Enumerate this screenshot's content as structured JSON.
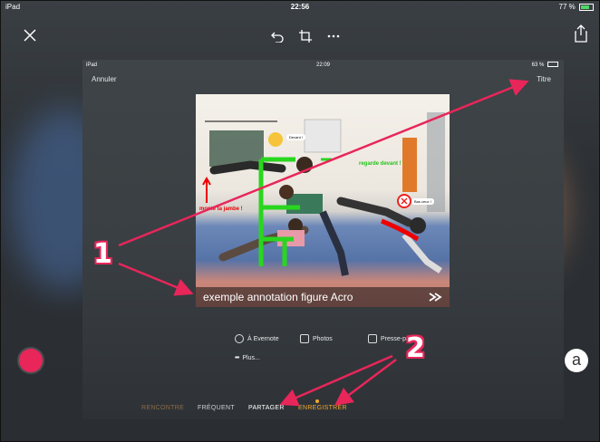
{
  "status": {
    "device": "iPad",
    "time": "22:56",
    "battery": "77 %"
  },
  "inner": {
    "status": {
      "device": "iPad",
      "time": "22:09",
      "battery": "63 %"
    },
    "nav": {
      "cancel": "Annuler",
      "title": "Titre"
    },
    "photo": {
      "caption": "exemple annotation figure Acro",
      "annotations": [
        {
          "text": "Devant !"
        },
        {
          "text": "regarde devant !"
        },
        {
          "text": "monte ta jambe !"
        },
        {
          "text": "Bas ceux !"
        }
      ]
    },
    "share": [
      {
        "label": "À Evernote",
        "icon": "evernote-icon"
      },
      {
        "label": "Photos",
        "icon": "photos-icon"
      },
      {
        "label": "Presse-pa...",
        "icon": "clipboard-icon"
      },
      {
        "label": "Plus...",
        "icon": "more-icon"
      }
    ],
    "tabs": [
      {
        "label": "RENCONTRE",
        "color": "#8a6a4a"
      },
      {
        "label": "FRÉQUENT",
        "color": "#d0d0d0"
      },
      {
        "label": "PARTAGER",
        "color": "#ffffff"
      },
      {
        "label": "ENREGISTRER",
        "color": "#f0a830"
      }
    ]
  },
  "floating": {
    "circle_label": "a"
  },
  "callouts": {
    "one": "1",
    "two": "2"
  },
  "colors": {
    "accent": "#e8265a",
    "active_tab": "#f0a830"
  }
}
